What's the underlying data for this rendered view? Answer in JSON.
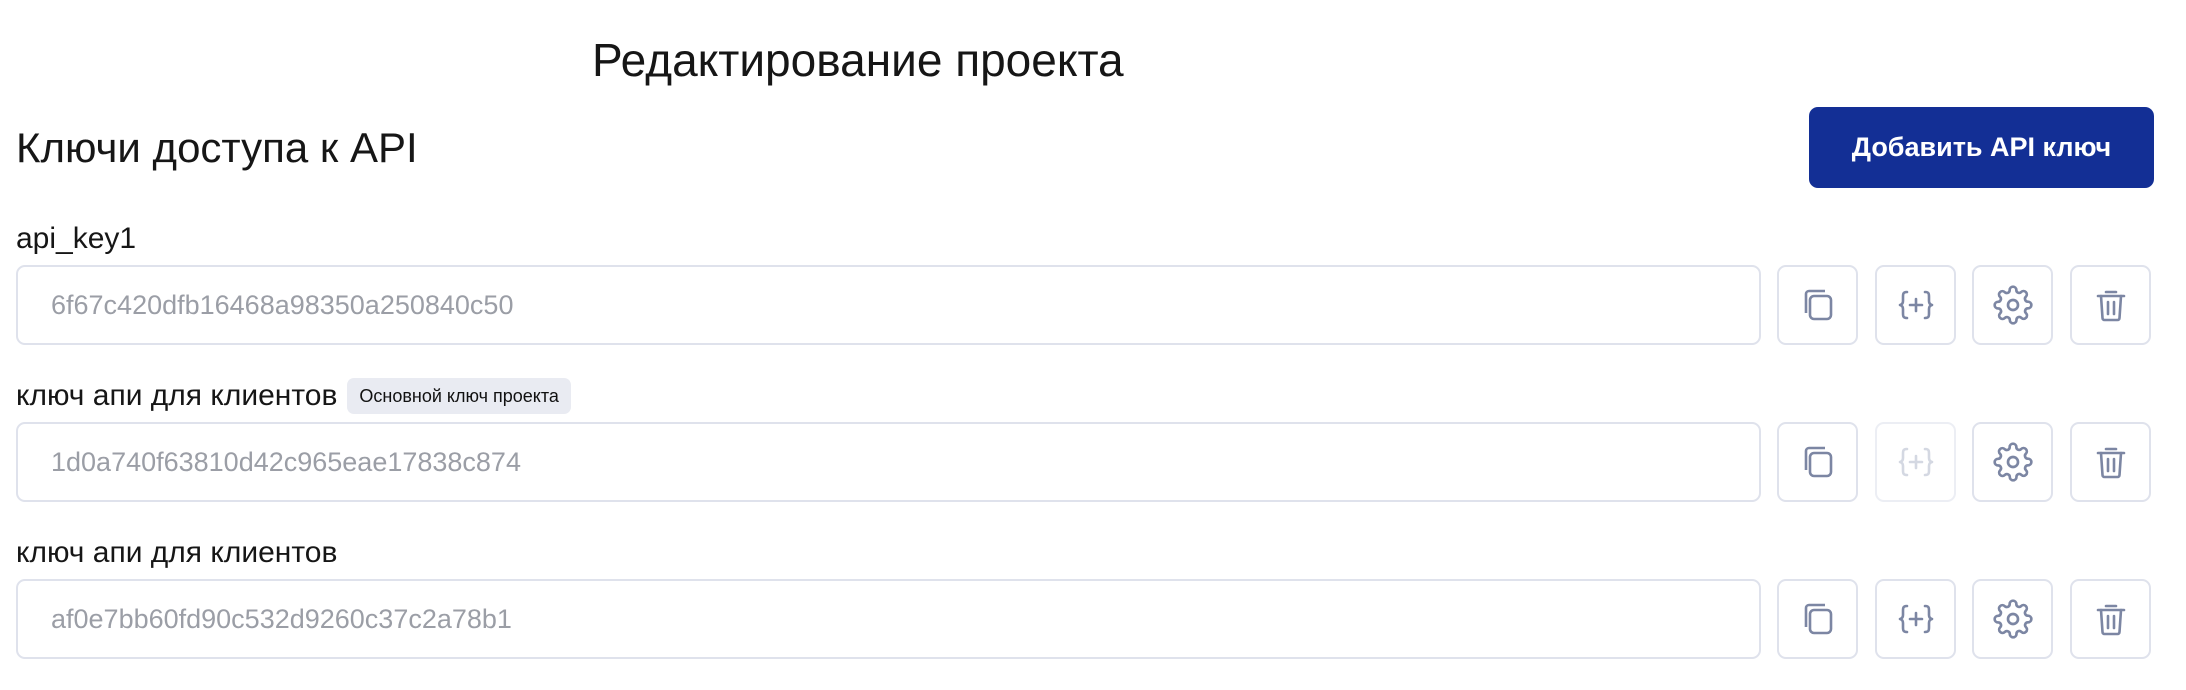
{
  "page": {
    "title": "Редактирование проекта"
  },
  "section": {
    "title": "Ключи доступа к API",
    "add_button_label": "Добавить API ключ"
  },
  "colors": {
    "primary": "#132f95",
    "border": "#dfe2ec",
    "icon": "#7c86a3",
    "icon_disabled": "#d4d8e2",
    "badge_bg": "#e9ebf2"
  },
  "api_keys": [
    {
      "name": "api_key1",
      "badge": "",
      "value": "6f67c420dfb16468a98350a250840c50",
      "actions": [
        {
          "icon": "copy-icon",
          "enabled": true
        },
        {
          "icon": "code-braces-plus-icon",
          "enabled": true
        },
        {
          "icon": "gear-icon",
          "enabled": true
        },
        {
          "icon": "trash-icon",
          "enabled": true
        }
      ]
    },
    {
      "name": "ключ апи для клиентов",
      "badge": "Основной ключ проекта",
      "value": "1d0a740f63810d42c965eae17838c874",
      "actions": [
        {
          "icon": "copy-icon",
          "enabled": true
        },
        {
          "icon": "code-braces-plus-icon",
          "enabled": false
        },
        {
          "icon": "gear-icon",
          "enabled": true
        },
        {
          "icon": "trash-icon",
          "enabled": true
        }
      ]
    },
    {
      "name": "ключ апи для клиентов",
      "badge": "",
      "value": "af0e7bb60fd90c532d9260c37c2a78b1",
      "actions": [
        {
          "icon": "copy-icon",
          "enabled": true
        },
        {
          "icon": "code-braces-plus-icon",
          "enabled": true
        },
        {
          "icon": "gear-icon",
          "enabled": true
        },
        {
          "icon": "trash-icon",
          "enabled": true
        }
      ]
    }
  ]
}
